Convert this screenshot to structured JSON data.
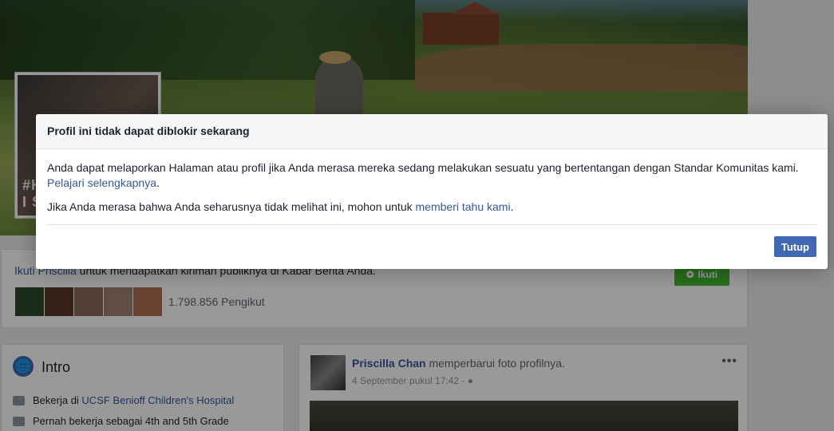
{
  "background_page": {
    "profile_tag_lines": [
      "#H",
      "I S"
    ],
    "follow_text_link": "Ikuti Priscilla",
    "follow_text_rest": " untuk mendapatkan kiriman publiknya di Kabar Berita Anda.",
    "follow_button_label": "Ikuti",
    "follower_count": "1.798.856 Pengikut",
    "follower_avatar_colors": [
      "#2a4a2a",
      "#5a3a2a",
      "#8a6a55",
      "#a08070",
      "#b07050"
    ],
    "intro": {
      "title": "Intro",
      "work_prefix": "Bekerja di ",
      "work_link": "UCSF Benioff Children's Hospital",
      "past_work": "Pernah bekerja sebagai 4th and 5th Grade"
    },
    "post": {
      "author": "Priscilla Chan",
      "action": " memperbarui foto profilnya.",
      "time": "4 September pukul 17:42 · ",
      "menu_icon": "more-dots-icon",
      "privacy_icon": "globe-icon"
    }
  },
  "dialog": {
    "title": "Profil ini tidak dapat diblokir sekarang",
    "para1_text": "Anda dapat melaporkan Halaman atau profil jika Anda merasa mereka sedang melakukan sesuatu yang bertentangan dengan Standar Komunitas kami. ",
    "para1_link": "Pelajari selengkapnya",
    "para1_end": ".",
    "para2_text": "Jika Anda merasa bahwa Anda seharusnya tidak melihat ini, mohon untuk ",
    "para2_link": "memberi tahu kami",
    "para2_end": ".",
    "close_button": "Tutup"
  },
  "colors": {
    "link": "#365899",
    "primary_button": "#4267b2",
    "follow_button": "#42b72a",
    "overlay": "rgba(0,0,0,0.4)"
  }
}
